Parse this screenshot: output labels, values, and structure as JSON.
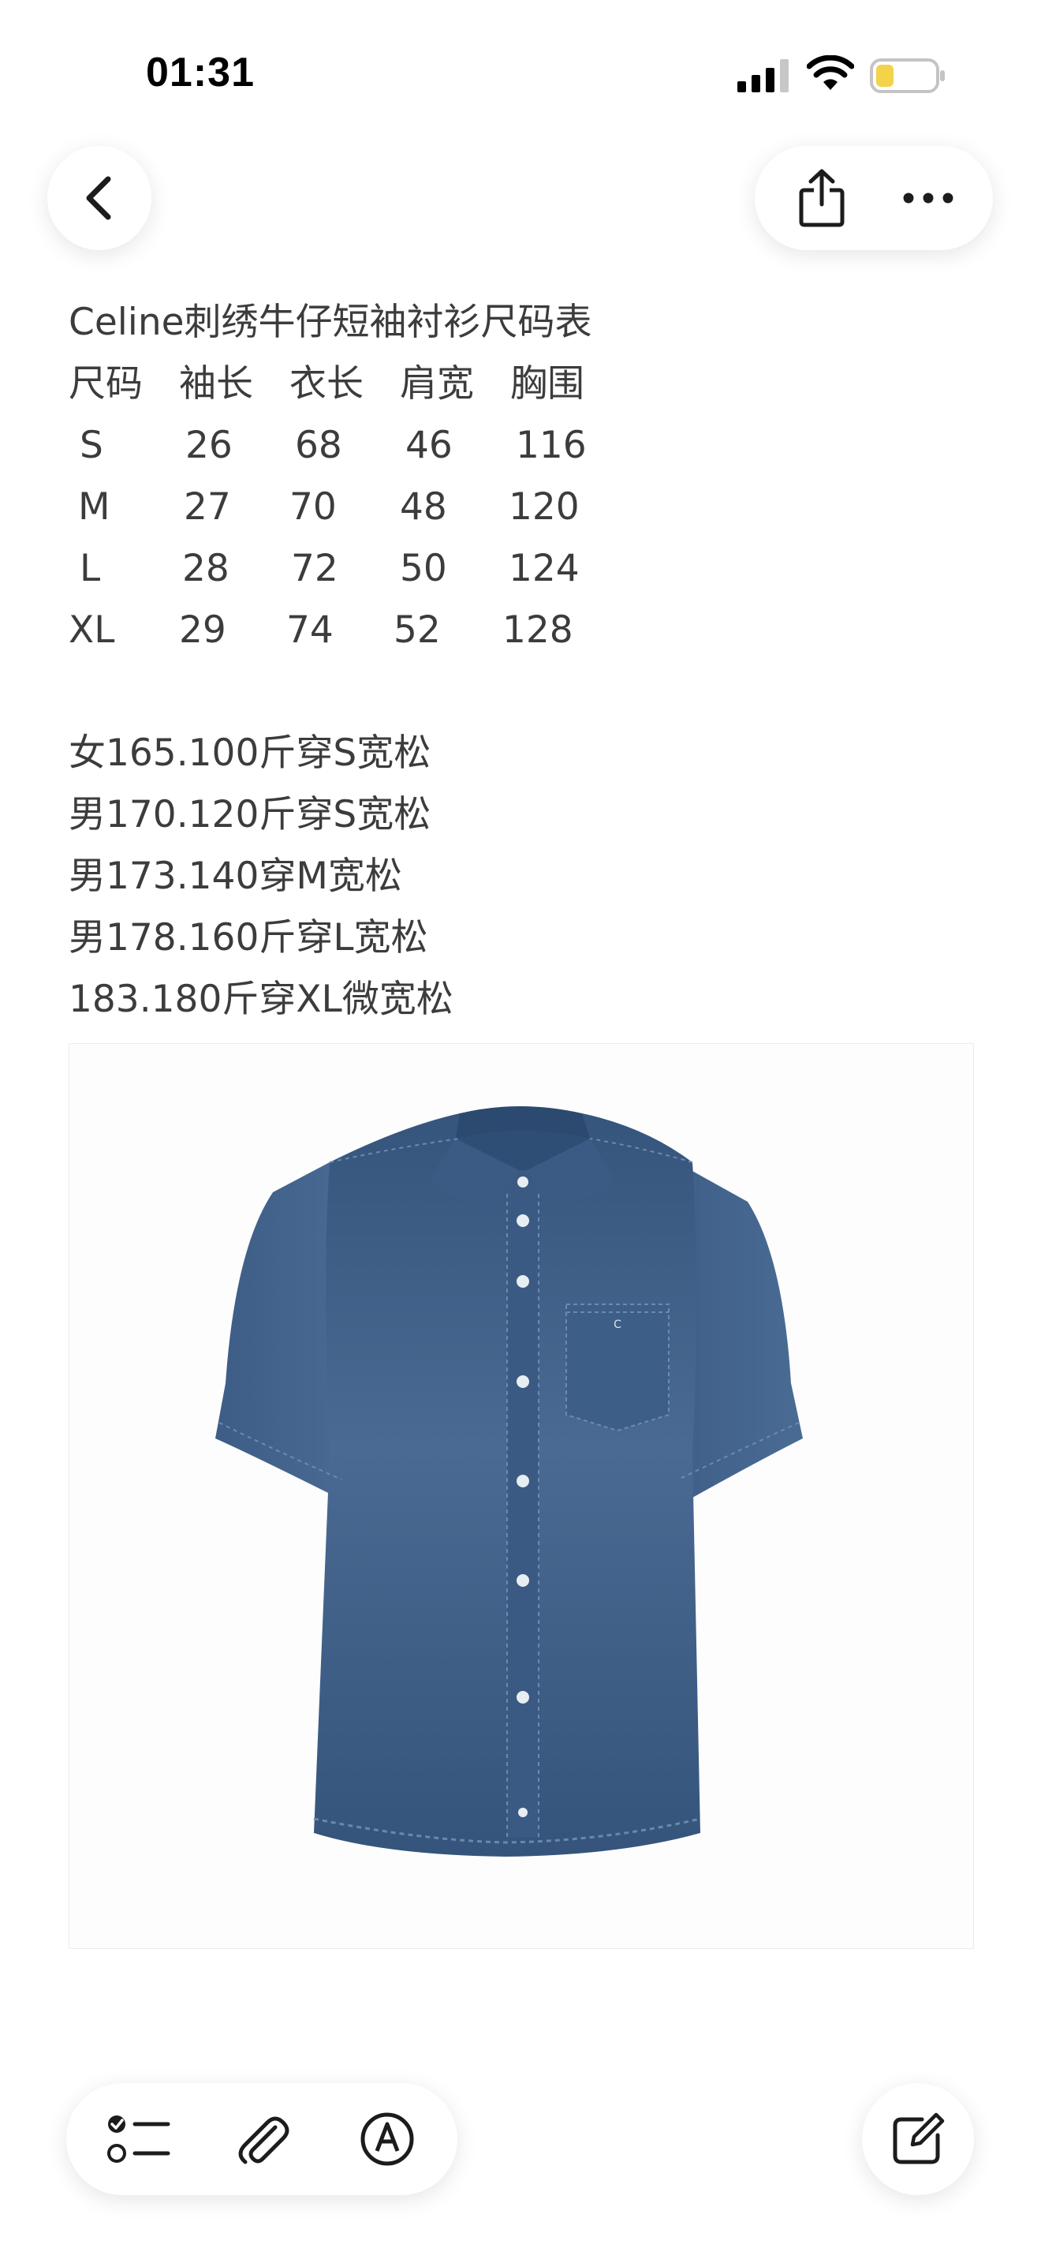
{
  "status_bar": {
    "time": "01:31",
    "battery_color": "#f3d34a"
  },
  "note": {
    "title": "Celine刺绣牛仔短袖衬衫尺码表",
    "size_table": {
      "headers": [
        "尺码",
        "袖长",
        "衣长",
        "肩宽",
        "胸围"
      ],
      "rows": [
        [
          "S",
          "26",
          "68",
          "46",
          "116"
        ],
        [
          "M",
          "27",
          "70",
          "48",
          "120"
        ],
        [
          "L",
          "28",
          "72",
          "50",
          "124"
        ],
        [
          "XL",
          "29",
          "74",
          "52",
          "128"
        ]
      ]
    },
    "recommendations": [
      "女165.100斤穿S宽松",
      "男170.120斤穿S宽松",
      "男173.140穿M宽松",
      "男178.160斤穿L宽松",
      "183.180斤穿XL微宽松"
    ]
  },
  "icons": {
    "back": "chevron-left-icon",
    "share": "share-icon",
    "more": "ellipsis-icon",
    "checklist": "checklist-icon",
    "attach": "paperclip-icon",
    "markup": "markup-pen-icon",
    "compose": "compose-icon"
  },
  "colors": {
    "denim": "#3f5f86",
    "denim_dark": "#2d4a6e",
    "icon": "#1c1c1e"
  }
}
